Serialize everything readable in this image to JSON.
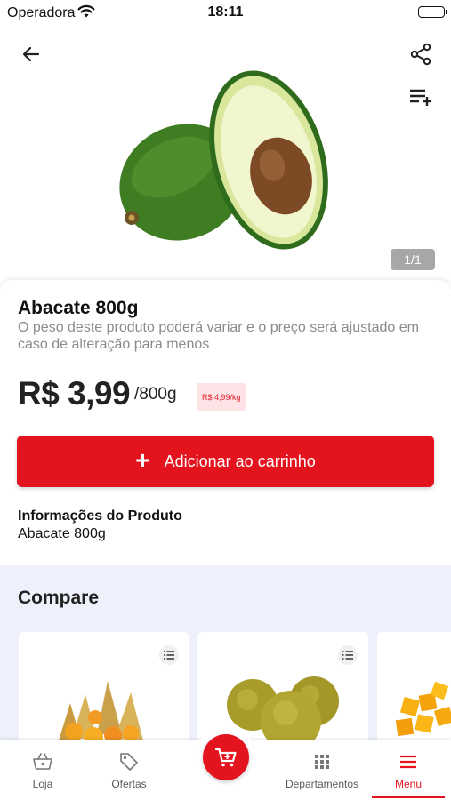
{
  "status_bar": {
    "carrier": "Operadora",
    "time": "18:11"
  },
  "header": {
    "back_icon": "arrow-left-icon",
    "share_icon": "share-icon",
    "add_to_list_icon": "playlist-add-icon"
  },
  "gallery": {
    "counter": "1/1"
  },
  "product": {
    "name": "Abacate 800g",
    "weight_note": "O peso deste produto poderá variar e o preço será ajustado em caso de alteração para menos",
    "price": "R$ 3,99",
    "unit": "/800g",
    "unit_price": "R$ 4,99/kg",
    "add_to_cart_label": "Adicionar ao carrinho",
    "info_heading": "Informações do Produto",
    "info_text": "Abacate 800g"
  },
  "compare": {
    "title": "Compare"
  },
  "bottom_nav": {
    "items": [
      {
        "label": "Loja",
        "icon": "basket-icon"
      },
      {
        "label": "Ofertas",
        "icon": "tag-icon"
      },
      {
        "label": "Departamentos",
        "icon": "grid-icon"
      },
      {
        "label": "Menu",
        "icon": "hamburger-menu-icon"
      }
    ],
    "cart_icon": "cart-icon"
  },
  "colors": {
    "brand_red": "#e4141f",
    "badge_bg": "#fde3e5",
    "compare_bg": "#eef1fc"
  }
}
